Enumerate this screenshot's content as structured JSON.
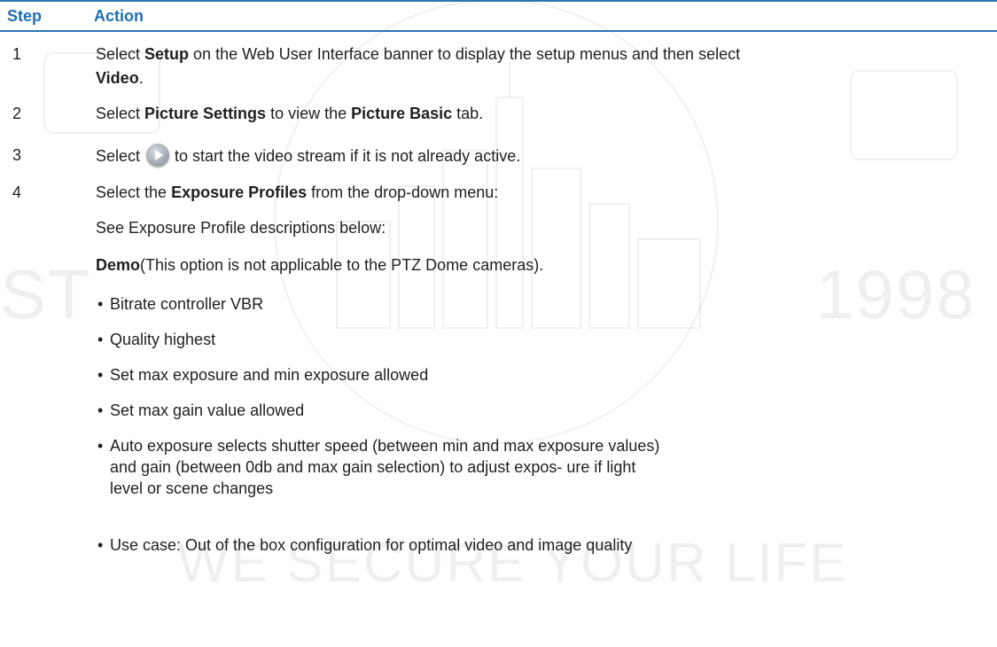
{
  "table": {
    "headers": {
      "step": "Step",
      "action": "Action"
    },
    "steps": [
      {
        "number": "1",
        "parts": {
          "a": "Select ",
          "b": "Setup",
          "c": " on the Web User Interface banner to display the setup menus and then select",
          "d": "Video",
          "e": "."
        }
      },
      {
        "number": "2",
        "parts": {
          "a": "Select ",
          "b": "Picture Settings",
          "c": " to view the ",
          "d": "Picture Basic",
          "e": " tab."
        }
      },
      {
        "number": "3",
        "parts": {
          "a": "Select",
          "icon": "play-icon",
          "b": "to start the video stream if it is not already active."
        }
      },
      {
        "number": "4",
        "parts": {
          "a": "Select the ",
          "b": "Exposure Profiles",
          "c": " from the drop-down menu:"
        },
        "see_line": "See Exposure Profile descriptions below:",
        "profile": {
          "name": "Demo",
          "note": "(This option is not applicable to the PTZ Dome cameras)."
        },
        "bullets": [
          "Bitrate controller VBR",
          "Quality highest",
          "Set max exposure and min exposure allowed",
          "Set max gain value allowed",
          "Auto exposure selects shutter speed (between min and max exposure values) and gain (between 0db and max gain selection) to adjust expos- ure if light level or scene changes",
          "Use case: Out of the box configuration for optimal video and image quality"
        ]
      }
    ]
  },
  "watermark": {
    "left": "ST",
    "right": "1998",
    "slogan": "WE SECURE YOUR LIFE"
  }
}
